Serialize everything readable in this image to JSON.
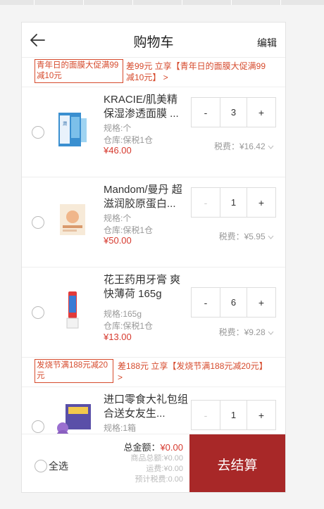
{
  "header": {
    "title": "购物车",
    "edit_label": "编辑"
  },
  "groups": [
    {
      "promo_tag": "青年日的面膜大促满99减10元",
      "promo_text": "差99元 立享【青年日的面膜大促满99减10元】 >",
      "items": [
        {
          "name": "KRACIE/肌美精 保湿渗透面膜 ...",
          "spec": "规格:个",
          "store": "仓库:保税1仓",
          "price": "¥46.00",
          "qty": "3",
          "minus": "-",
          "plus": "+",
          "tax": "税费：¥16.42"
        },
        {
          "name": "Mandom/曼丹 超滋润胶原蛋白...",
          "spec": "规格:个",
          "store": "仓库:保税1仓",
          "price": "¥50.00",
          "qty": "1",
          "minus": "-",
          "plus": "+",
          "tax": "税费：¥5.95"
        },
        {
          "name": "花王药用牙膏 爽快薄荷 165g",
          "spec": "规格:165g",
          "store": "仓库:保税1仓",
          "price": "¥13.00",
          "qty": "6",
          "minus": "-",
          "plus": "+",
          "tax": "税费：¥9.28"
        }
      ]
    },
    {
      "promo_tag": "发烧节满188元减20元",
      "promo_text": "差188元 立享【发烧节满188元减20元】 >",
      "items": [
        {
          "name": "进口零食大礼包组合送女友生...",
          "spec": "规格:1箱",
          "qty": "1",
          "minus": "-",
          "plus": "+"
        }
      ]
    }
  ],
  "footer": {
    "select_all": "全选",
    "total_label": "总金额：",
    "total_value": "¥0.00",
    "goods_total": "商品总额:¥0.00",
    "shipping": "运费:¥0.00",
    "est_tax": "预计税费:0.00",
    "checkout_label": "去结算"
  },
  "colors": {
    "accent": "#a82828",
    "price": "#d63a2f",
    "promo": "#d64a2c"
  }
}
